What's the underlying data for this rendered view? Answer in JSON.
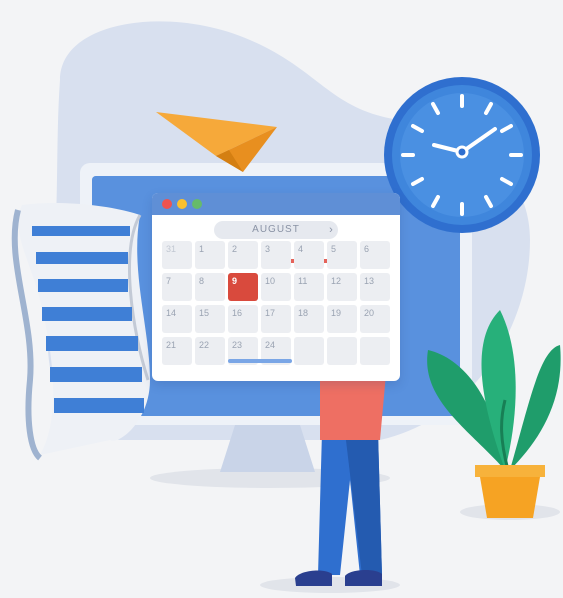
{
  "calendar": {
    "month": "AUGUST",
    "prev_icon": "chevron-left-icon",
    "next_icon": "chevron-right-icon",
    "days": [
      "31",
      "1",
      "2",
      "3",
      "4",
      "5",
      "6",
      "7",
      "8",
      "9",
      "10",
      "11",
      "12",
      "13",
      "14",
      "15",
      "16",
      "17",
      "18",
      "19",
      "20",
      "21",
      "22",
      "23",
      "24",
      "",
      "",
      ""
    ],
    "selected_day": "9"
  },
  "window_controls": [
    "close-dot",
    "minimize-dot",
    "maximize-dot"
  ],
  "colors": {
    "accent_blue": "#3f7fd6",
    "selected_red": "#d94a3d",
    "plane_orange": "#f6a93a",
    "shirt": "#ee6f63",
    "pants": "#2f6fcf",
    "leaf_green": "#1f9d6b",
    "pot": "#f6a323"
  },
  "icons": [
    "paper-plane-icon",
    "wall-clock-icon",
    "plant-icon",
    "document-scroll-icon"
  ]
}
